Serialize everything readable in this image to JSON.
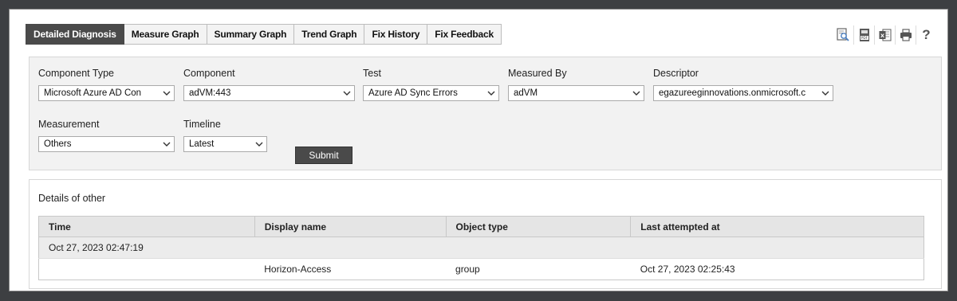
{
  "tabs": [
    {
      "label": "Detailed Diagnosis",
      "active": true
    },
    {
      "label": "Measure Graph"
    },
    {
      "label": "Summary Graph"
    },
    {
      "label": "Trend Graph"
    },
    {
      "label": "Fix History"
    },
    {
      "label": "Fix Feedback"
    }
  ],
  "toolbar": {
    "icons": [
      "search-report-icon",
      "pdf-icon",
      "excel-icon",
      "print-icon",
      "help-icon"
    ],
    "help_glyph": "?"
  },
  "filters": {
    "component_type": {
      "label": "Component Type",
      "value": "Microsoft Azure AD Con"
    },
    "component": {
      "label": "Component",
      "value": "adVM:443"
    },
    "test": {
      "label": "Test",
      "value": "Azure AD Sync Errors"
    },
    "measured_by": {
      "label": "Measured By",
      "value": "adVM"
    },
    "descriptor": {
      "label": "Descriptor",
      "value": "egazureeginnovations.onmicrosoft.c"
    },
    "measurement": {
      "label": "Measurement",
      "value": "Others"
    },
    "timeline": {
      "label": "Timeline",
      "value": "Latest"
    },
    "submit_label": "Submit"
  },
  "details": {
    "title": "Details of other",
    "columns": [
      "Time",
      "Display name",
      "Object type",
      "Last attempted at"
    ],
    "group_time": "Oct 27, 2023 02:47:19",
    "rows": [
      {
        "time": "",
        "display_name": "Horizon-Access",
        "object_type": "group",
        "last_attempted": "Oct 27, 2023 02:25:43"
      }
    ]
  }
}
